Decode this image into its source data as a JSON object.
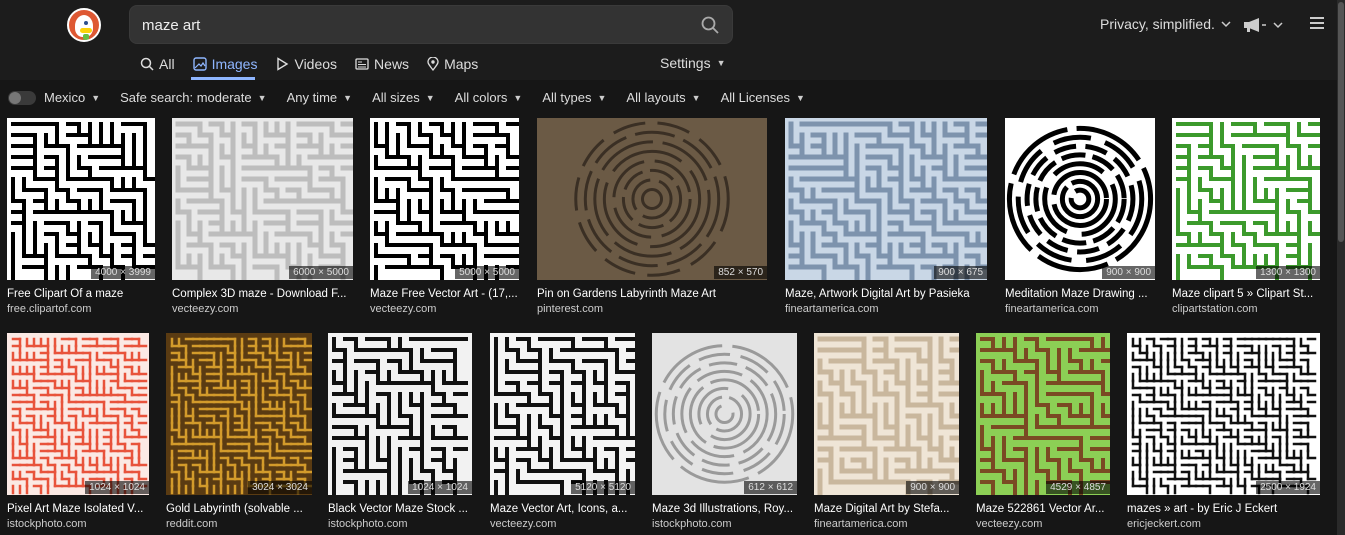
{
  "search": {
    "query": "maze art"
  },
  "header": {
    "privacy_label": "Privacy, simplified."
  },
  "tabs": [
    {
      "label": "All",
      "icon": "search-icon"
    },
    {
      "label": "Images",
      "icon": "image-icon"
    },
    {
      "label": "Videos",
      "icon": "play-icon"
    },
    {
      "label": "News",
      "icon": "newspaper-icon"
    },
    {
      "label": "Maps",
      "icon": "map-pin-icon"
    }
  ],
  "settings_label": "Settings",
  "filters": [
    {
      "label": "Mexico"
    },
    {
      "label": "Safe search: moderate"
    },
    {
      "label": "Any time"
    },
    {
      "label": "All sizes"
    },
    {
      "label": "All colors"
    },
    {
      "label": "All types"
    },
    {
      "label": "All layouts"
    },
    {
      "label": "All Licenses"
    }
  ],
  "results": [
    {
      "title": "Free Clipart Of a maze",
      "source": "free.clipartof.com",
      "dims": "4000 × 3999",
      "style": "square-maze"
    },
    {
      "title": "Complex 3D maze - Download F...",
      "source": "vecteezy.com",
      "dims": "6000 × 5000",
      "style": "white-3d"
    },
    {
      "title": "Maze Free Vector Art - (17,...",
      "source": "vecteezy.com",
      "dims": "5000 × 5000",
      "style": "square-maze"
    },
    {
      "title": "Pin on Gardens Labyrinth Maze Art",
      "source": "pinterest.com",
      "dims": "852 × 570",
      "style": "stone-labyrinth"
    },
    {
      "title": "Maze, Artwork Digital Art by Pasieka",
      "source": "fineartamerica.com",
      "dims": "900 × 675",
      "style": "blue-3d"
    },
    {
      "title": "Meditation Maze Drawing ...",
      "source": "fineartamerica.com",
      "dims": "900 × 900",
      "style": "spiral-bw"
    },
    {
      "title": "Maze clipart 5 » Clipart St...",
      "source": "clipartstation.com",
      "dims": "1300 × 1300",
      "style": "hedge"
    },
    {
      "title": "Pixel Art Maze Isolated V...",
      "source": "istockphoto.com",
      "dims": "1024 × 1024",
      "style": "pixel-red"
    },
    {
      "title": "Gold Labyrinth (solvable ...",
      "source": "reddit.com",
      "dims": "3024 × 3024",
      "style": "gold"
    },
    {
      "title": "Black Vector Maze Stock ...",
      "source": "istockphoto.com",
      "dims": "1024 × 1024",
      "style": "square-maze-light"
    },
    {
      "title": "Maze Vector Art, Icons, a...",
      "source": "vecteezy.com",
      "dims": "5120 × 5120",
      "style": "square-maze-simple"
    },
    {
      "title": "Maze 3d Illustrations, Roy...",
      "source": "istockphoto.com",
      "dims": "612 × 612",
      "style": "circle-grey"
    },
    {
      "title": "Maze Digital Art by Stefa...",
      "source": "fineartamerica.com",
      "dims": "900 × 900",
      "style": "cream-3d"
    },
    {
      "title": "Maze 522861 Vector Ar...",
      "source": "vecteezy.com",
      "dims": "4529 × 4857",
      "style": "cartoon"
    },
    {
      "title": "mazes » art - by Eric J Eckert",
      "source": "ericjeckert.com",
      "dims": "2500 × 1924",
      "style": "doodle"
    }
  ]
}
